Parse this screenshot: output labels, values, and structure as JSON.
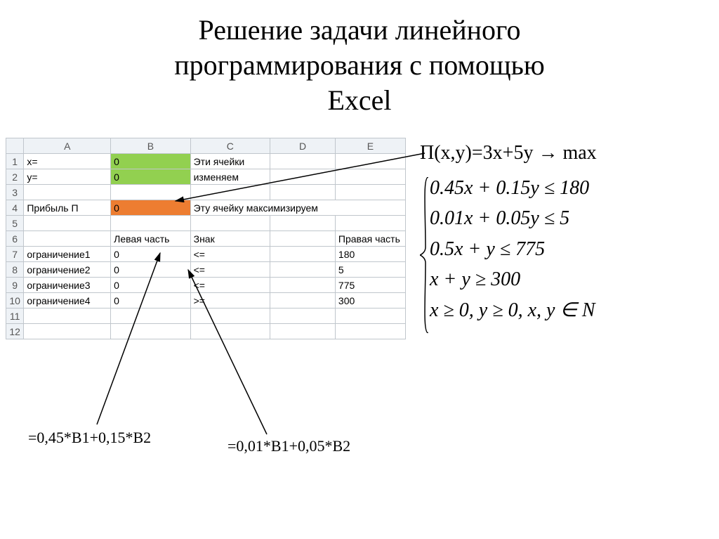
{
  "title_line1": "Решение задачи линейного",
  "title_line2": "программирования с помощью",
  "title_line3": "Excel",
  "sheet": {
    "headers": {
      "corner": "",
      "A": "A",
      "B": "B",
      "C": "C",
      "D": "D",
      "E": "E"
    },
    "rows": [
      {
        "n": "1",
        "A": "x=",
        "B": "0",
        "C": "Эти ячейки",
        "D": "",
        "E": "",
        "Bclass": "fill-green"
      },
      {
        "n": "2",
        "A": "y=",
        "B": "0",
        "C": "изменяем",
        "D": "",
        "E": "",
        "Bclass": "fill-green"
      },
      {
        "n": "3",
        "A": "",
        "B": "",
        "C": "",
        "D": "",
        "E": ""
      },
      {
        "n": "4",
        "A": "Прибыль П",
        "B": "0",
        "C": "Эту ячейку максимизируем",
        "D": "",
        "E": "",
        "Bclass": "fill-orange",
        "Cspan": 3
      },
      {
        "n": "5",
        "A": "",
        "B": "",
        "C": "",
        "D": "",
        "E": ""
      },
      {
        "n": "6",
        "A": "",
        "B": "Левая часть",
        "C": "Знак",
        "D": "",
        "E": "Правая часть"
      },
      {
        "n": "7",
        "A": "ограничение1",
        "B": "0",
        "C": "<=",
        "D": "",
        "E": "180",
        "Bnum": true,
        "Enum": true
      },
      {
        "n": "8",
        "A": "ограничение2",
        "B": "0",
        "C": "<=",
        "D": "",
        "E": "5",
        "Bnum": true,
        "Enum": true
      },
      {
        "n": "9",
        "A": "ограничение3",
        "B": "0",
        "C": "<=",
        "D": "",
        "E": "775",
        "Bnum": true,
        "Enum": true
      },
      {
        "n": "10",
        "A": "ограничение4",
        "B": "0",
        "C": ">=",
        "D": "",
        "E": "300",
        "Bnum": true,
        "Enum": true
      },
      {
        "n": "11",
        "A": "",
        "B": "",
        "C": "",
        "D": "",
        "E": ""
      },
      {
        "n": "12",
        "A": "",
        "B": "",
        "C": "",
        "D": "",
        "E": ""
      }
    ]
  },
  "objective": {
    "prefix": "П(x,y)=3x+5y",
    "arrow": " → ",
    "suffix": "max"
  },
  "constraints": [
    "0.45x + 0.15y ≤ 180",
    "0.01x + 0.05y ≤ 5",
    "0.5x + y ≤ 775",
    "x + y ≥ 300",
    "x ≥ 0, y ≥ 0, x, y ∈ N"
  ],
  "formula1": "=0,45*B1+0,15*B2",
  "formula2": "=0,01*B1+0,05*B2"
}
